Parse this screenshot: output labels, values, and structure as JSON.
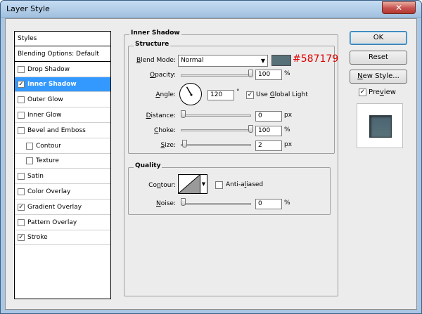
{
  "window": {
    "title": "Layer Style",
    "close_glyph": "✕"
  },
  "styles": [
    {
      "label": "Styles",
      "type": "header"
    },
    {
      "label": "Blending Options: Default",
      "type": "header"
    },
    {
      "label": "Drop Shadow",
      "checked": false
    },
    {
      "label": "Inner Shadow",
      "checked": true,
      "selected": true
    },
    {
      "label": "Outer Glow",
      "checked": false
    },
    {
      "label": "Inner Glow",
      "checked": false
    },
    {
      "label": "Bevel and Emboss",
      "checked": false
    },
    {
      "label": "Contour",
      "checked": false,
      "indent": true
    },
    {
      "label": "Texture",
      "checked": false,
      "indent": true
    },
    {
      "label": "Satin",
      "checked": false
    },
    {
      "label": "Color Overlay",
      "checked": false
    },
    {
      "label": "Gradient Overlay",
      "checked": true
    },
    {
      "label": "Pattern Overlay",
      "checked": false
    },
    {
      "label": "Stroke",
      "checked": true
    }
  ],
  "panel": {
    "section_title": "Inner Shadow",
    "structure_title": "Structure",
    "blend_mode_label": "Blend Mode:",
    "blend_mode_value": "Normal",
    "shadow_color": "#587179",
    "shadow_color_label": "#587179",
    "opacity_label": "Opacity:",
    "opacity_value": "100",
    "opacity_fraction": 1.0,
    "opacity_unit": "%",
    "angle_label": "Angle:",
    "angle_value": "120",
    "angle_unit": "°",
    "use_global_light_label": "Use Global Light",
    "use_global_light": true,
    "distance_label": "Distance:",
    "distance_value": "0",
    "distance_fraction": 0.0,
    "distance_unit": "px",
    "choke_label": "Choke:",
    "choke_value": "100",
    "choke_fraction": 1.0,
    "choke_unit": "%",
    "size_label": "Size:",
    "size_value": "2",
    "size_fraction": 0.02,
    "size_unit": "px",
    "quality_title": "Quality",
    "contour_label": "Contour:",
    "anti_aliased_label": "Anti-aliased",
    "anti_aliased": false,
    "noise_label": "Noise:",
    "noise_value": "0",
    "noise_fraction": 0.0,
    "noise_unit": "%"
  },
  "buttons": {
    "ok": "OK",
    "reset": "Reset",
    "new_style": "New Style...",
    "preview_label": "Preview",
    "preview_checked": true
  },
  "glyphs": {
    "check": "✓",
    "dropdown": "▼"
  }
}
